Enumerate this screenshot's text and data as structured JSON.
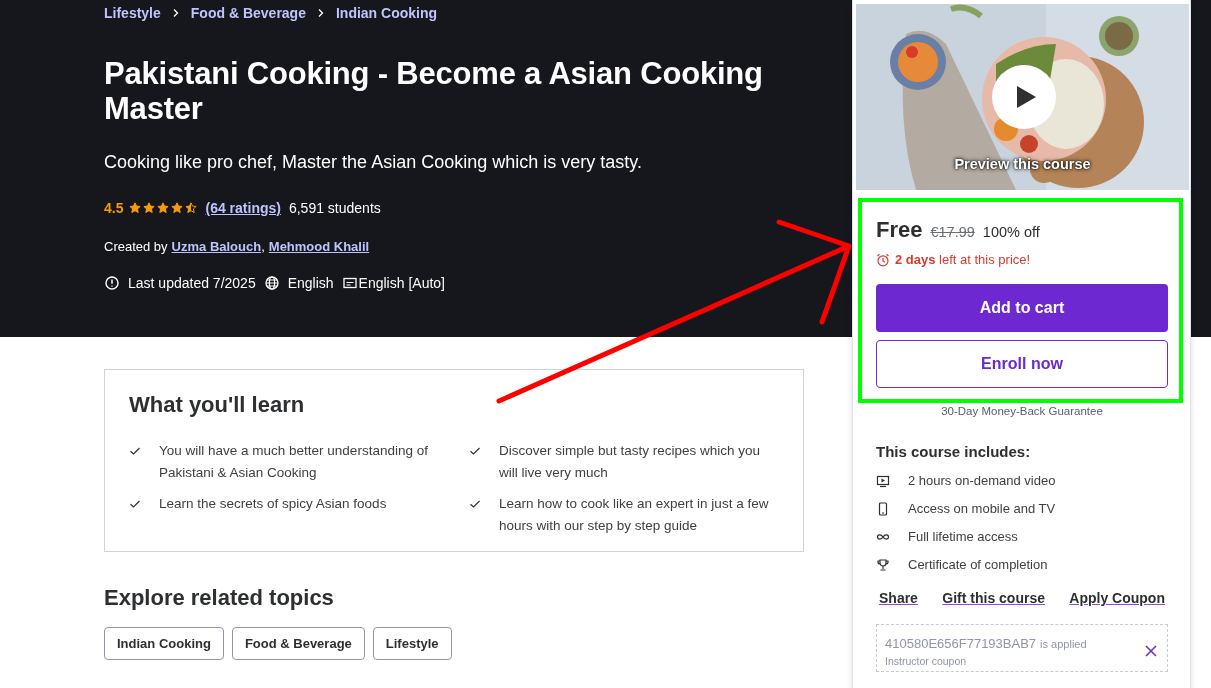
{
  "breadcrumb": [
    "Lifestyle",
    "Food & Beverage",
    "Indian Cooking"
  ],
  "title": "Pakistani Cooking - Become a Asian Cooking Master",
  "subtitle": "Cooking like pro chef, Master the Asian Cooking which is very tasty.",
  "rating": {
    "score": "4.5",
    "stars": 4.5,
    "ratings_link": "(64 ratings)",
    "students": "6,591 students"
  },
  "created_by": {
    "label": "Created by",
    "authors": [
      "Uzma Balouch",
      "Mehmood Khalil"
    ],
    "separator": ","
  },
  "meta": [
    {
      "kind": "updated",
      "text": "Last updated 7/2025"
    },
    {
      "kind": "language",
      "text": "English"
    },
    {
      "kind": "captions",
      "text": "English [Auto]"
    }
  ],
  "learn": {
    "title": "What you'll learn",
    "items": [
      "You will have a much better understanding of Pakistani & Asian Cooking",
      "Discover simple but tasty recipes which you will live very much",
      "Learn the secrets of spicy Asian foods",
      "Learn how to cook like an expert in just a few hours with our step by step guide"
    ]
  },
  "related": {
    "title": "Explore related topics",
    "topics": [
      "Indian Cooking",
      "Food & Beverage",
      "Lifestyle"
    ]
  },
  "sidebar": {
    "preview": {
      "kind": "picture",
      "label": "Preview this course"
    },
    "price": {
      "current": "Free",
      "original": "€17.99",
      "discount": "100% off"
    },
    "deadline": "**2 days** left at this price!",
    "buttons": [
      {
        "kind": "primary",
        "label": "Add to cart"
      },
      {
        "kind": "secondary",
        "label": "Enroll now"
      }
    ],
    "guarantee": "30-Day Money-Back Guarantee",
    "includes": {
      "title": "This course includes:",
      "items": [
        {
          "kind": "video",
          "text": "2 hours on-demand video"
        },
        {
          "kind": "mobile",
          "text": "Access on mobile and TV"
        },
        {
          "kind": "infinity",
          "text": "Full lifetime access"
        },
        {
          "kind": "trophy",
          "text": "Certificate of completion"
        }
      ]
    },
    "links": [
      "Share",
      "Gift this course",
      "Apply Coupon"
    ],
    "coupon": {
      "code": "410580E656F77193BAB7",
      "note": "is applied",
      "label": "Instructor coupon"
    }
  },
  "annotations": [
    {
      "kind": "arrow",
      "color": "#ff0000"
    },
    {
      "kind": "highlight",
      "color": "#00ff00"
    }
  ]
}
